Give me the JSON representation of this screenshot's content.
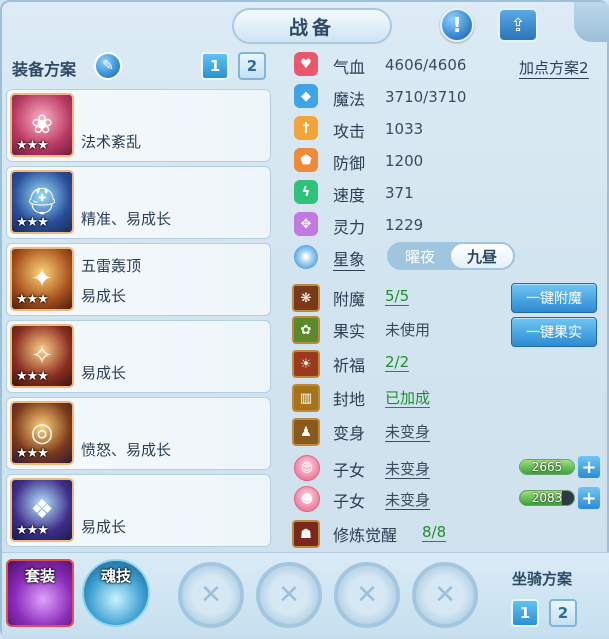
{
  "header": {
    "title": "战备",
    "info_icon": "exclamation-icon",
    "share_icon": "share-icon",
    "info_glyph": "!",
    "share_glyph": "⇪"
  },
  "equip_plan": {
    "label": "装备方案",
    "edit_icon": "pencil-icon",
    "edit_glyph": "✎",
    "plan_buttons": [
      "1",
      "2"
    ],
    "active_plan": "1",
    "stars": "★★★",
    "items": [
      {
        "lines": [
          "法术紊乱"
        ],
        "icon": "fan-weapon-icon"
      },
      {
        "lines": [
          "精准、易成长"
        ],
        "icon": "helmet-icon"
      },
      {
        "lines": [
          "五雷轰顶",
          "易成长"
        ],
        "icon": "necklace-icon"
      },
      {
        "lines": [
          "易成长"
        ],
        "icon": "armor-icon"
      },
      {
        "lines": [
          "愤怒、易成长"
        ],
        "icon": "belt-icon"
      },
      {
        "lines": [
          "易成长"
        ],
        "icon": "boots-icon"
      }
    ]
  },
  "attributes": {
    "plan_link": "加点方案2",
    "rows": [
      {
        "label": "气血",
        "value": "4606/4606",
        "icon": "heart-icon",
        "color": "#e8576a"
      },
      {
        "label": "魔法",
        "value": "3710/3710",
        "icon": "magic-icon",
        "color": "#3fa3e8"
      },
      {
        "label": "攻击",
        "value": "1033",
        "icon": "sword-icon",
        "color": "#f2a53a"
      },
      {
        "label": "防御",
        "value": "1200",
        "icon": "shield-icon",
        "color": "#ef8a3a"
      },
      {
        "label": "速度",
        "value": "371",
        "icon": "speed-icon",
        "color": "#2ec27a"
      },
      {
        "label": "灵力",
        "value": "1229",
        "icon": "spirit-icon",
        "color": "#c07ae0"
      }
    ],
    "star": {
      "label": "星象",
      "options": [
        "曜夜",
        "九昼"
      ],
      "selected": "九昼",
      "icon": "star-icon"
    }
  },
  "status": {
    "enchant": {
      "label": "附魔",
      "value": "5/5",
      "button": "一键附魔",
      "icon": "enchant-icon"
    },
    "fruit": {
      "label": "果实",
      "value": "未使用",
      "button": "一键果实",
      "icon": "fruit-icon"
    },
    "blessing": {
      "label": "祈福",
      "value": "2/2",
      "icon": "blessing-icon"
    },
    "seal": {
      "label": "封地",
      "value": "已加成",
      "icon": "territory-icon"
    },
    "transform": {
      "label": "变身",
      "value": "未变身",
      "icon": "transform-icon"
    },
    "children": [
      {
        "label": "子女",
        "value": "未变身",
        "bar_value": "2665",
        "fill": 1.0,
        "icon": "child-girl-icon"
      },
      {
        "label": "子女",
        "value": "未变身",
        "bar_value": "2083",
        "fill": 0.78,
        "icon": "child-boy-icon"
      }
    ],
    "cultivation": {
      "label": "修炼觉醒",
      "value": "8/8",
      "icon": "cultivation-icon"
    }
  },
  "bottom": {
    "set_label": "套装",
    "soul_label": "魂技",
    "empty_slots": 4,
    "slot_glyph": "✕",
    "mount_label": "坐骑方案",
    "mount_buttons": [
      "1",
      "2"
    ],
    "active_mount": "1"
  },
  "glyphs": {
    "plus": "+"
  }
}
